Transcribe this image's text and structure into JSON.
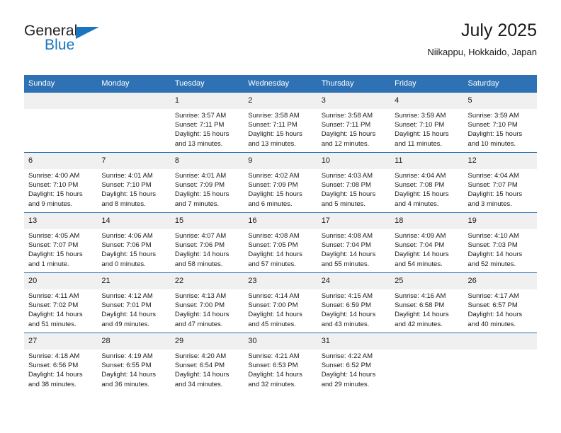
{
  "brand": {
    "name_top": "General",
    "name_bottom": "Blue",
    "accent_color": "#1b75bc"
  },
  "header": {
    "title": "July 2025",
    "subtitle": "Niikappu, Hokkaido, Japan"
  },
  "theme": {
    "header_blue": "#2e72b5",
    "daynum_band": "#f0f0f0",
    "text": "#1a1a1a"
  },
  "calendar": {
    "weekday_headers": [
      "Sunday",
      "Monday",
      "Tuesday",
      "Wednesday",
      "Thursday",
      "Friday",
      "Saturday"
    ],
    "weeks": [
      [
        {
          "day": "",
          "blank": true,
          "sunrise": "",
          "sunset": "",
          "daylight": ""
        },
        {
          "day": "",
          "blank": true,
          "sunrise": "",
          "sunset": "",
          "daylight": ""
        },
        {
          "day": "1",
          "sunrise": "Sunrise: 3:57 AM",
          "sunset": "Sunset: 7:11 PM",
          "daylight": "Daylight: 15 hours and 13 minutes."
        },
        {
          "day": "2",
          "sunrise": "Sunrise: 3:58 AM",
          "sunset": "Sunset: 7:11 PM",
          "daylight": "Daylight: 15 hours and 13 minutes."
        },
        {
          "day": "3",
          "sunrise": "Sunrise: 3:58 AM",
          "sunset": "Sunset: 7:11 PM",
          "daylight": "Daylight: 15 hours and 12 minutes."
        },
        {
          "day": "4",
          "sunrise": "Sunrise: 3:59 AM",
          "sunset": "Sunset: 7:10 PM",
          "daylight": "Daylight: 15 hours and 11 minutes."
        },
        {
          "day": "5",
          "sunrise": "Sunrise: 3:59 AM",
          "sunset": "Sunset: 7:10 PM",
          "daylight": "Daylight: 15 hours and 10 minutes."
        }
      ],
      [
        {
          "day": "6",
          "sunrise": "Sunrise: 4:00 AM",
          "sunset": "Sunset: 7:10 PM",
          "daylight": "Daylight: 15 hours and 9 minutes."
        },
        {
          "day": "7",
          "sunrise": "Sunrise: 4:01 AM",
          "sunset": "Sunset: 7:10 PM",
          "daylight": "Daylight: 15 hours and 8 minutes."
        },
        {
          "day": "8",
          "sunrise": "Sunrise: 4:01 AM",
          "sunset": "Sunset: 7:09 PM",
          "daylight": "Daylight: 15 hours and 7 minutes."
        },
        {
          "day": "9",
          "sunrise": "Sunrise: 4:02 AM",
          "sunset": "Sunset: 7:09 PM",
          "daylight": "Daylight: 15 hours and 6 minutes."
        },
        {
          "day": "10",
          "sunrise": "Sunrise: 4:03 AM",
          "sunset": "Sunset: 7:08 PM",
          "daylight": "Daylight: 15 hours and 5 minutes."
        },
        {
          "day": "11",
          "sunrise": "Sunrise: 4:04 AM",
          "sunset": "Sunset: 7:08 PM",
          "daylight": "Daylight: 15 hours and 4 minutes."
        },
        {
          "day": "12",
          "sunrise": "Sunrise: 4:04 AM",
          "sunset": "Sunset: 7:07 PM",
          "daylight": "Daylight: 15 hours and 3 minutes."
        }
      ],
      [
        {
          "day": "13",
          "sunrise": "Sunrise: 4:05 AM",
          "sunset": "Sunset: 7:07 PM",
          "daylight": "Daylight: 15 hours and 1 minute."
        },
        {
          "day": "14",
          "sunrise": "Sunrise: 4:06 AM",
          "sunset": "Sunset: 7:06 PM",
          "daylight": "Daylight: 15 hours and 0 minutes."
        },
        {
          "day": "15",
          "sunrise": "Sunrise: 4:07 AM",
          "sunset": "Sunset: 7:06 PM",
          "daylight": "Daylight: 14 hours and 58 minutes."
        },
        {
          "day": "16",
          "sunrise": "Sunrise: 4:08 AM",
          "sunset": "Sunset: 7:05 PM",
          "daylight": "Daylight: 14 hours and 57 minutes."
        },
        {
          "day": "17",
          "sunrise": "Sunrise: 4:08 AM",
          "sunset": "Sunset: 7:04 PM",
          "daylight": "Daylight: 14 hours and 55 minutes."
        },
        {
          "day": "18",
          "sunrise": "Sunrise: 4:09 AM",
          "sunset": "Sunset: 7:04 PM",
          "daylight": "Daylight: 14 hours and 54 minutes."
        },
        {
          "day": "19",
          "sunrise": "Sunrise: 4:10 AM",
          "sunset": "Sunset: 7:03 PM",
          "daylight": "Daylight: 14 hours and 52 minutes."
        }
      ],
      [
        {
          "day": "20",
          "sunrise": "Sunrise: 4:11 AM",
          "sunset": "Sunset: 7:02 PM",
          "daylight": "Daylight: 14 hours and 51 minutes."
        },
        {
          "day": "21",
          "sunrise": "Sunrise: 4:12 AM",
          "sunset": "Sunset: 7:01 PM",
          "daylight": "Daylight: 14 hours and 49 minutes."
        },
        {
          "day": "22",
          "sunrise": "Sunrise: 4:13 AM",
          "sunset": "Sunset: 7:00 PM",
          "daylight": "Daylight: 14 hours and 47 minutes."
        },
        {
          "day": "23",
          "sunrise": "Sunrise: 4:14 AM",
          "sunset": "Sunset: 7:00 PM",
          "daylight": "Daylight: 14 hours and 45 minutes."
        },
        {
          "day": "24",
          "sunrise": "Sunrise: 4:15 AM",
          "sunset": "Sunset: 6:59 PM",
          "daylight": "Daylight: 14 hours and 43 minutes."
        },
        {
          "day": "25",
          "sunrise": "Sunrise: 4:16 AM",
          "sunset": "Sunset: 6:58 PM",
          "daylight": "Daylight: 14 hours and 42 minutes."
        },
        {
          "day": "26",
          "sunrise": "Sunrise: 4:17 AM",
          "sunset": "Sunset: 6:57 PM",
          "daylight": "Daylight: 14 hours and 40 minutes."
        }
      ],
      [
        {
          "day": "27",
          "sunrise": "Sunrise: 4:18 AM",
          "sunset": "Sunset: 6:56 PM",
          "daylight": "Daylight: 14 hours and 38 minutes."
        },
        {
          "day": "28",
          "sunrise": "Sunrise: 4:19 AM",
          "sunset": "Sunset: 6:55 PM",
          "daylight": "Daylight: 14 hours and 36 minutes."
        },
        {
          "day": "29",
          "sunrise": "Sunrise: 4:20 AM",
          "sunset": "Sunset: 6:54 PM",
          "daylight": "Daylight: 14 hours and 34 minutes."
        },
        {
          "day": "30",
          "sunrise": "Sunrise: 4:21 AM",
          "sunset": "Sunset: 6:53 PM",
          "daylight": "Daylight: 14 hours and 32 minutes."
        },
        {
          "day": "31",
          "sunrise": "Sunrise: 4:22 AM",
          "sunset": "Sunset: 6:52 PM",
          "daylight": "Daylight: 14 hours and 29 minutes."
        },
        {
          "day": "",
          "blank": true,
          "sunrise": "",
          "sunset": "",
          "daylight": ""
        },
        {
          "day": "",
          "blank": true,
          "sunrise": "",
          "sunset": "",
          "daylight": ""
        }
      ]
    ]
  }
}
